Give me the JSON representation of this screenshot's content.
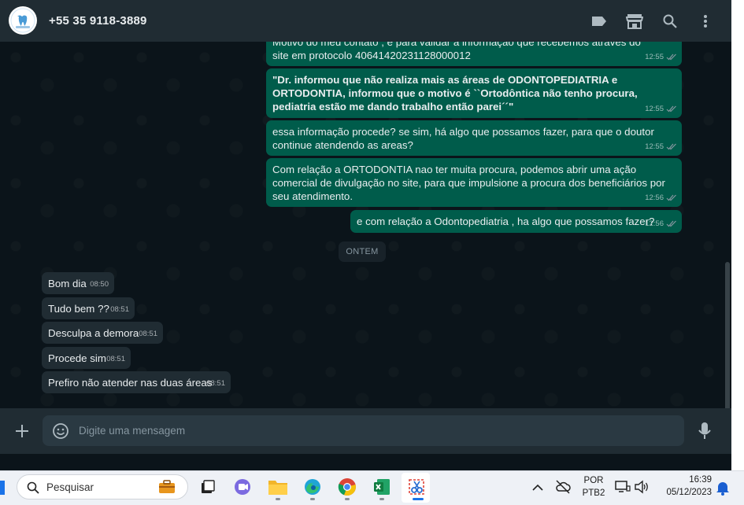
{
  "header": {
    "contact_name": "+55 35 9118-3889",
    "avatar_icon": "clinic-logo-icon",
    "icons": [
      "label-icon",
      "store-icon",
      "search-icon",
      "menu-icon"
    ]
  },
  "messages_out": [
    {
      "text": "Motivo do meu contato , é para validar a informação que recebemos através do site em protocolo 40641420231128000012",
      "time": "12:55"
    },
    {
      "text": "\"Dr. informou que não realiza mais as áreas de ODONTOPEDIATRIA e ORTODONTIA, informou que o motivo é ``Ortodôntica não tenho procura, pediatria estão me dando trabalho então parei´´\"",
      "time": "12:55"
    },
    {
      "text": "essa informação procede? se sim, há algo que possamos fazer, para que o doutor continue atendendo as areas?",
      "time": "12:55"
    },
    {
      "text": "Com relação a ORTODONTIA  nao ter muita procura, podemos abrir uma ação comercial de divulgação no site, para que impulsione a procura dos beneficiários por seu atendimento.",
      "time": "12:56"
    },
    {
      "text": "e com relação a Odontopediatria , ha algo que possamos fazer?",
      "time": "12:56"
    }
  ],
  "date_divider": "ONTEM",
  "messages_in": [
    {
      "text": "Bom dia",
      "time": "08:50"
    },
    {
      "text": "Tudo bem ??",
      "time": "08:51"
    },
    {
      "text": "Desculpa a demora",
      "time": "08:51"
    },
    {
      "text": "Procede sim",
      "time": "08:51"
    },
    {
      "text": "Prefiro não atender nas duas áreas",
      "time": "08:51"
    }
  ],
  "composer": {
    "placeholder": "Digite uma mensagem",
    "icons": [
      "plus-icon",
      "emoji-icon",
      "mic-icon"
    ]
  },
  "taskbar": {
    "search_placeholder": "Pesquisar",
    "apps": [
      "briefcase-icon",
      "task-view-icon",
      "teams-icon",
      "file-explorer-icon",
      "edge-icon",
      "chrome-icon",
      "excel-icon",
      "snipping-tool-icon"
    ],
    "language_line1": "POR",
    "language_line2": "PTB2",
    "time": "16:39",
    "date": "05/12/2023"
  },
  "colors": {
    "header_bg": "#202c33",
    "chat_bg": "#0b141a",
    "outgoing_bubble": "#005c4b",
    "incoming_bubble": "#202c33",
    "text": "#e9edef",
    "muted": "#8696a0"
  }
}
